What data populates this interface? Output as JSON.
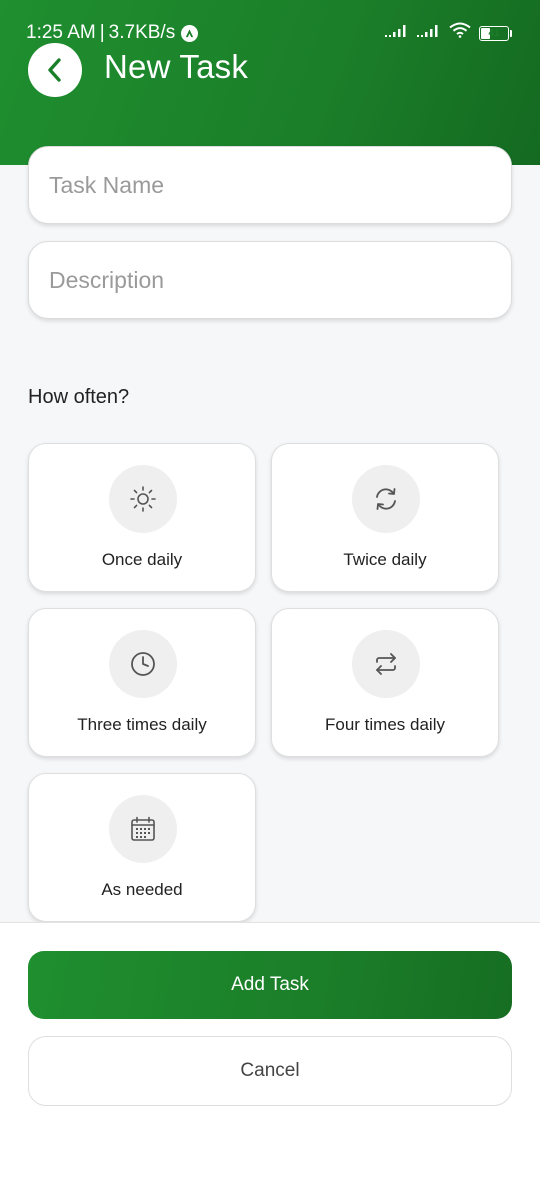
{
  "status_bar": {
    "time": "1:25 AM",
    "network_speed": "3.7KB/s",
    "battery_level": 41,
    "battery_text": "41",
    "icons": [
      "signal-icon",
      "signal-icon",
      "wifi-icon",
      "battery-icon"
    ]
  },
  "header": {
    "title": "New Task",
    "back_icon": "chevron-left-icon",
    "accent_color": "#1b7e29"
  },
  "form": {
    "task_name": {
      "placeholder": "Task Name",
      "value": ""
    },
    "description": {
      "placeholder": "Description",
      "value": ""
    }
  },
  "frequency": {
    "label": "How often?",
    "options": [
      {
        "label": "Once daily",
        "icon": "sun-icon"
      },
      {
        "label": "Twice daily",
        "icon": "refresh-icon"
      },
      {
        "label": "Three times daily",
        "icon": "clock-icon"
      },
      {
        "label": "Four times daily",
        "icon": "repeat-icon"
      },
      {
        "label": "As needed",
        "icon": "calendar-icon"
      }
    ]
  },
  "actions": {
    "add_label": "Add Task",
    "cancel_label": "Cancel"
  }
}
